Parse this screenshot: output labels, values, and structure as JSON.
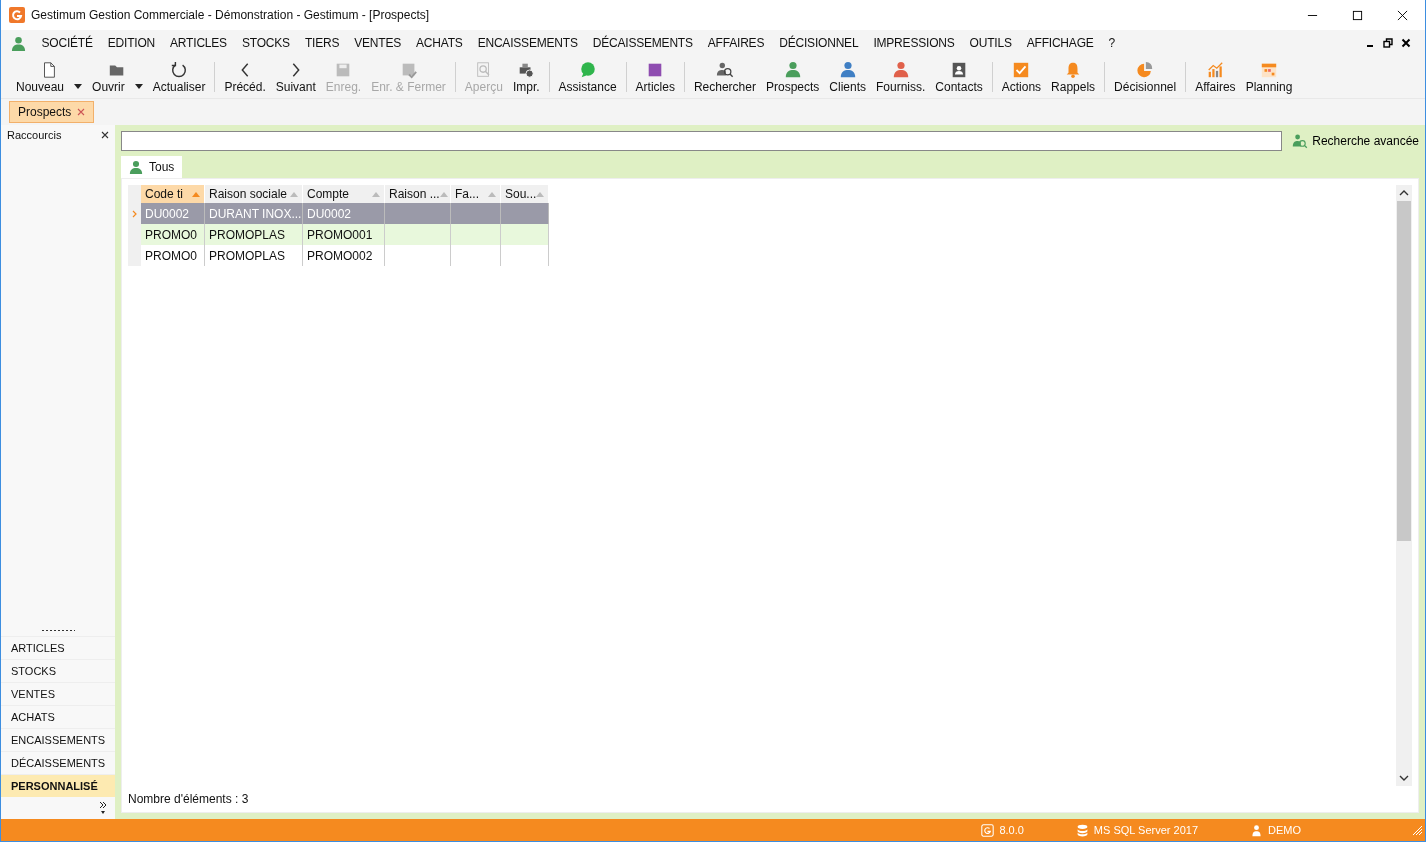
{
  "window": {
    "title": "Gestimum Gestion Commerciale - Démonstration - Gestimum - [Prospects]"
  },
  "menu": [
    "SOCIÉTÉ",
    "EDITION",
    "ARTICLES",
    "STOCKS",
    "TIERS",
    "VENTES",
    "ACHATS",
    "ENCAISSEMENTS",
    "DÉCAISSEMENTS",
    "AFFAIRES",
    "DÉCISIONNEL",
    "IMPRESSIONS",
    "OUTILS",
    "AFFICHAGE",
    "?"
  ],
  "toolbar": [
    [
      {
        "label": "Nouveau",
        "disabled": false,
        "dropdown": true
      },
      {
        "label": "Ouvrir",
        "disabled": false,
        "dropdown": true
      },
      {
        "label": "Actualiser",
        "disabled": false,
        "dropdown": false
      }
    ],
    [
      {
        "label": "Précéd.",
        "disabled": false,
        "dropdown": false
      },
      {
        "label": "Suivant",
        "disabled": false,
        "dropdown": false
      },
      {
        "label": "Enreg.",
        "disabled": true,
        "dropdown": false
      },
      {
        "label": "Enr. & Fermer",
        "disabled": true,
        "dropdown": false
      }
    ],
    [
      {
        "label": "Aperçu",
        "disabled": true,
        "dropdown": false
      },
      {
        "label": "Impr.",
        "disabled": false,
        "dropdown": false
      }
    ],
    [
      {
        "label": "Assistance",
        "disabled": false,
        "dropdown": false
      }
    ],
    [
      {
        "label": "Articles",
        "disabled": false,
        "dropdown": false
      }
    ],
    [
      {
        "label": "Rechercher",
        "disabled": false,
        "dropdown": false
      },
      {
        "label": "Prospects",
        "disabled": false,
        "dropdown": false
      },
      {
        "label": "Clients",
        "disabled": false,
        "dropdown": false
      },
      {
        "label": "Fourniss.",
        "disabled": false,
        "dropdown": false
      },
      {
        "label": "Contacts",
        "disabled": false,
        "dropdown": false
      }
    ],
    [
      {
        "label": "Actions",
        "disabled": false,
        "dropdown": false
      },
      {
        "label": "Rappels",
        "disabled": false,
        "dropdown": false
      }
    ],
    [
      {
        "label": "Décisionnel",
        "disabled": false,
        "dropdown": false
      }
    ],
    [
      {
        "label": "Affaires",
        "disabled": false,
        "dropdown": false
      },
      {
        "label": "Planning",
        "disabled": false,
        "dropdown": false
      }
    ]
  ],
  "doc_tabs": [
    {
      "label": "Prospects",
      "selected": true
    }
  ],
  "shortcuts": {
    "title": "Raccourcis",
    "items": [
      {
        "label": "ARTICLES",
        "selected": false
      },
      {
        "label": "STOCKS",
        "selected": false
      },
      {
        "label": "VENTES",
        "selected": false
      },
      {
        "label": "ACHATS",
        "selected": false
      },
      {
        "label": "ENCAISSEMENTS",
        "selected": false
      },
      {
        "label": "DÉCAISSEMENTS",
        "selected": false
      },
      {
        "label": "PERSONNALISÉ",
        "selected": true
      }
    ]
  },
  "search": {
    "button": "Recherche avancée"
  },
  "view_tabs": [
    {
      "label": "Tous",
      "selected": true
    }
  ],
  "table": {
    "columns": [
      {
        "label": "Code ti",
        "sorted": true
      },
      {
        "label": "Raison sociale",
        "sorted": false
      },
      {
        "label": "Compte",
        "sorted": false
      },
      {
        "label": "Raison ...",
        "sorted": false
      },
      {
        "label": "Fa...",
        "sorted": false
      },
      {
        "label": "Sou...",
        "sorted": false
      }
    ],
    "rows": [
      {
        "cells": [
          "DU0002",
          "DURANT INOX...",
          "DU0002"
        ],
        "selected": true
      },
      {
        "cells": [
          "PROMO0",
          "PROMOPLAS",
          "PROMO001"
        ],
        "selected": false
      },
      {
        "cells": [
          "PROMO0",
          "PROMOPLAS",
          "PROMO002"
        ],
        "selected": false
      }
    ]
  },
  "count": "Nombre d'éléments : 3",
  "status_bar": {
    "version": "8.0.0",
    "database": "MS SQL Server 2017",
    "user": "DEMO"
  }
}
